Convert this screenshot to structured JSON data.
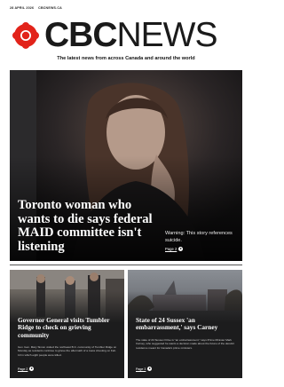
{
  "header": {
    "date": "28 APRIL 2026",
    "site": "CBCNEWS.CA",
    "logo_text_bold": "CBC",
    "logo_text_light": "NEWS",
    "tagline": "The latest news from across Canada and around the world"
  },
  "hero": {
    "headline": "Toronto woman who wants to die says federal MAID committee isn't listening",
    "warning": "Warning: This story references suicide.",
    "page_link": "Page 2"
  },
  "stories": [
    {
      "headline": "Governor General visits Tumbler Ridge to check on grieving community",
      "summary": "Gov. Gen. Mary Simon visited the northeast B.C. community of Tumbler Ridge on Monday as residents continue to grieve the aftermath of a mass shooting on Feb. 10 in which eight people were killed.",
      "page_link": "Page 2"
    },
    {
      "headline": "State of 24 Sussex 'an embarrassment,' says Carney",
      "summary": "The state of 24 Sussex Drive is \"an embarrassment,\" says Prime Minister Mark Carney, who suggested he wants a decision made about the future of the derelict residence meant for Canada's prime ministers.",
      "page_link": "Page 3"
    }
  ],
  "colors": {
    "brand_red": "#e2231a",
    "background": "#ffffff",
    "card_background": "#1c1c1d"
  }
}
